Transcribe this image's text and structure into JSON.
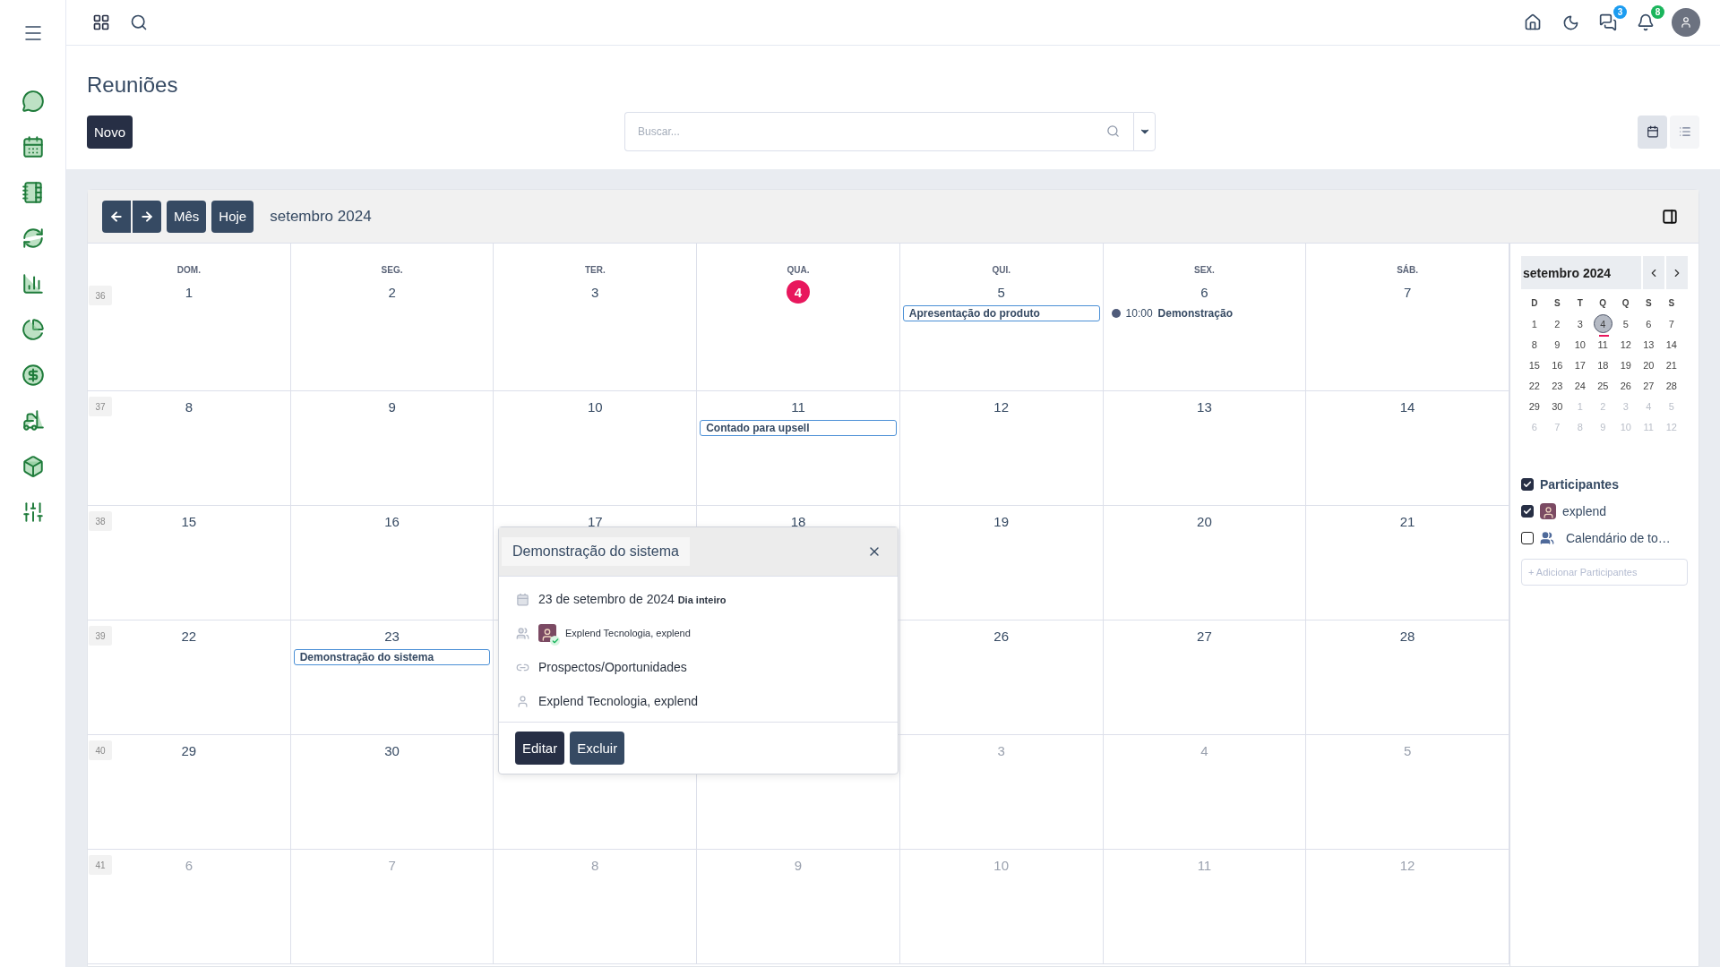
{
  "topbar": {
    "messages_badge": "3",
    "notifications_badge": "8"
  },
  "page": {
    "title": "Reuniões",
    "new_button": "Novo",
    "search": {
      "placeholder": "Buscar..."
    },
    "views": [
      {
        "kind": "calendar",
        "selected": true
      },
      {
        "kind": "list",
        "selected": false
      }
    ]
  },
  "calendar": {
    "nav_buttons": [
      "Mês",
      "Hoje"
    ],
    "title": "setembro 2024",
    "weekdays": [
      "DOM.",
      "SEG.",
      "TER.",
      "QUA.",
      "QUI.",
      "SEX.",
      "SÁB."
    ],
    "weeks": [
      {
        "number": "36",
        "days": [
          {
            "label": "1",
            "outside": false,
            "today": false
          },
          {
            "label": "2",
            "outside": false,
            "today": false
          },
          {
            "label": "3",
            "outside": false,
            "today": false
          },
          {
            "label": "4",
            "outside": false,
            "today": true
          },
          {
            "label": "5",
            "outside": false,
            "today": false,
            "events": [
              {
                "kind": "allday",
                "title": "Apresentação do produto"
              }
            ]
          },
          {
            "label": "6",
            "outside": false,
            "today": false,
            "events": [
              {
                "kind": "timed",
                "time": "10:00",
                "title": "Demonstração",
                "color": "#4f5b7a"
              }
            ]
          },
          {
            "label": "7",
            "outside": false,
            "today": false
          }
        ]
      },
      {
        "number": "37",
        "days": [
          {
            "label": "8",
            "outside": false,
            "today": false
          },
          {
            "label": "9",
            "outside": false,
            "today": false
          },
          {
            "label": "10",
            "outside": false,
            "today": false
          },
          {
            "label": "11",
            "outside": false,
            "today": false,
            "events": [
              {
                "kind": "allday",
                "title": "Contado para upsell"
              }
            ]
          },
          {
            "label": "12",
            "outside": false,
            "today": false
          },
          {
            "label": "13",
            "outside": false,
            "today": false
          },
          {
            "label": "14",
            "outside": false,
            "today": false
          }
        ]
      },
      {
        "number": "38",
        "days": [
          {
            "label": "15",
            "outside": false,
            "today": false
          },
          {
            "label": "16",
            "outside": false,
            "today": false
          },
          {
            "label": "17",
            "outside": false,
            "today": false
          },
          {
            "label": "18",
            "outside": false,
            "today": false
          },
          {
            "label": "19",
            "outside": false,
            "today": false
          },
          {
            "label": "20",
            "outside": false,
            "today": false
          },
          {
            "label": "21",
            "outside": false,
            "today": false
          }
        ]
      },
      {
        "number": "39",
        "days": [
          {
            "label": "22",
            "outside": false,
            "today": false
          },
          {
            "label": "23",
            "outside": false,
            "today": false,
            "events": [
              {
                "kind": "allday",
                "title": "Demonstração do sistema"
              }
            ]
          },
          {
            "label": "26",
            "outside": false,
            "today": false
          },
          {
            "label": "27",
            "outside": false,
            "today": false
          },
          {
            "label": "28",
            "outside": false,
            "today": false
          }
        ]
      },
      {
        "number": "40",
        "days": [
          {
            "label": "29",
            "outside": false,
            "today": false
          },
          {
            "label": "30",
            "outside": false,
            "today": false
          },
          {
            "label": "3",
            "outside": true,
            "today": false
          },
          {
            "label": "4",
            "outside": true,
            "today": false
          },
          {
            "label": "5",
            "outside": true,
            "today": false
          }
        ]
      },
      {
        "number": "41",
        "days": [
          {
            "label": "6",
            "outside": true,
            "today": false
          },
          {
            "label": "7",
            "outside": true,
            "today": false
          },
          {
            "label": "8",
            "outside": true,
            "today": false
          },
          {
            "label": "9",
            "outside": true,
            "today": false
          },
          {
            "label": "10",
            "outside": true,
            "today": false
          },
          {
            "label": "11",
            "outside": true,
            "today": false
          },
          {
            "label": "12",
            "outside": true,
            "today": false
          }
        ]
      }
    ],
    "popup": {
      "title": "Demonstração do sistema",
      "rows": [
        {
          "kind": "date",
          "text": "23 de setembro de 2024",
          "tag": "Dia inteiro"
        },
        {
          "kind": "attendees",
          "text": "Explend Tecnologia, explend"
        },
        {
          "kind": "link",
          "text": "Prospectos/Oportunidades"
        },
        {
          "kind": "organizer",
          "text": "Explend Tecnologia, explend"
        }
      ],
      "buttons": [
        {
          "label": "Editar",
          "kind": "primary"
        },
        {
          "label": "Excluir",
          "kind": "secondary"
        }
      ]
    }
  },
  "side_panel": {
    "mini_calendar": {
      "title": "setembro 2024",
      "weekdays": [
        "D",
        "S",
        "T",
        "Q",
        "Q",
        "S",
        "S"
      ],
      "weeks": [
        [
          {
            "label": "1",
            "outside": false,
            "selected": false
          },
          {
            "label": "2",
            "outside": false,
            "selected": false
          },
          {
            "label": "3",
            "outside": false,
            "selected": false
          },
          {
            "label": "4",
            "outside": false,
            "selected": true
          },
          {
            "label": "5",
            "outside": false,
            "selected": false
          },
          {
            "label": "6",
            "outside": false,
            "selected": false
          },
          {
            "label": "7",
            "outside": false,
            "selected": false
          }
        ],
        [
          {
            "label": "8",
            "outside": false,
            "selected": false
          },
          {
            "label": "9",
            "outside": false,
            "selected": false
          },
          {
            "label": "10",
            "outside": false,
            "selected": false
          },
          {
            "label": "11",
            "outside": false,
            "selected": false
          },
          {
            "label": "12",
            "outside": false,
            "selected": false
          },
          {
            "label": "13",
            "outside": false,
            "selected": false
          },
          {
            "label": "14",
            "outside": false,
            "selected": false
          }
        ],
        [
          {
            "label": "15",
            "outside": false,
            "selected": false
          },
          {
            "label": "16",
            "outside": false,
            "selected": false
          },
          {
            "label": "17",
            "outside": false,
            "selected": false
          },
          {
            "label": "18",
            "outside": false,
            "selected": false
          },
          {
            "label": "19",
            "outside": false,
            "selected": false
          },
          {
            "label": "20",
            "outside": false,
            "selected": false
          },
          {
            "label": "21",
            "outside": false,
            "selected": false
          }
        ],
        [
          {
            "label": "22",
            "outside": false,
            "selected": false
          },
          {
            "label": "23",
            "outside": false,
            "selected": false
          },
          {
            "label": "24",
            "outside": false,
            "selected": false
          },
          {
            "label": "25",
            "outside": false,
            "selected": false
          },
          {
            "label": "26",
            "outside": false,
            "selected": false
          },
          {
            "label": "27",
            "outside": false,
            "selected": false
          },
          {
            "label": "28",
            "outside": false,
            "selected": false
          }
        ],
        [
          {
            "label": "29",
            "outside": false,
            "selected": false
          },
          {
            "label": "30",
            "outside": false,
            "selected": false
          },
          {
            "label": "1",
            "outside": true,
            "selected": false
          },
          {
            "label": "2",
            "outside": true,
            "selected": false
          },
          {
            "label": "3",
            "outside": true,
            "selected": false
          },
          {
            "label": "4",
            "outside": true,
            "selected": false
          },
          {
            "label": "5",
            "outside": true,
            "selected": false
          }
        ],
        [
          {
            "label": "6",
            "outside": true,
            "selected": false
          },
          {
            "label": "7",
            "outside": true,
            "selected": false
          },
          {
            "label": "8",
            "outside": true,
            "selected": false
          },
          {
            "label": "9",
            "outside": true,
            "selected": false
          },
          {
            "label": "10",
            "outside": true,
            "selected": false
          },
          {
            "label": "11",
            "outside": true,
            "selected": false
          },
          {
            "label": "12",
            "outside": true,
            "selected": false
          }
        ]
      ]
    },
    "participants": {
      "header": {
        "label": "Participantes",
        "checked": true
      },
      "items": [
        {
          "label": "explend",
          "checked": true,
          "kind": "avatar"
        },
        {
          "label": "Calendário de to…",
          "checked": false,
          "kind": "group"
        }
      ],
      "add_button": "+ Adicionar Participantes"
    }
  }
}
